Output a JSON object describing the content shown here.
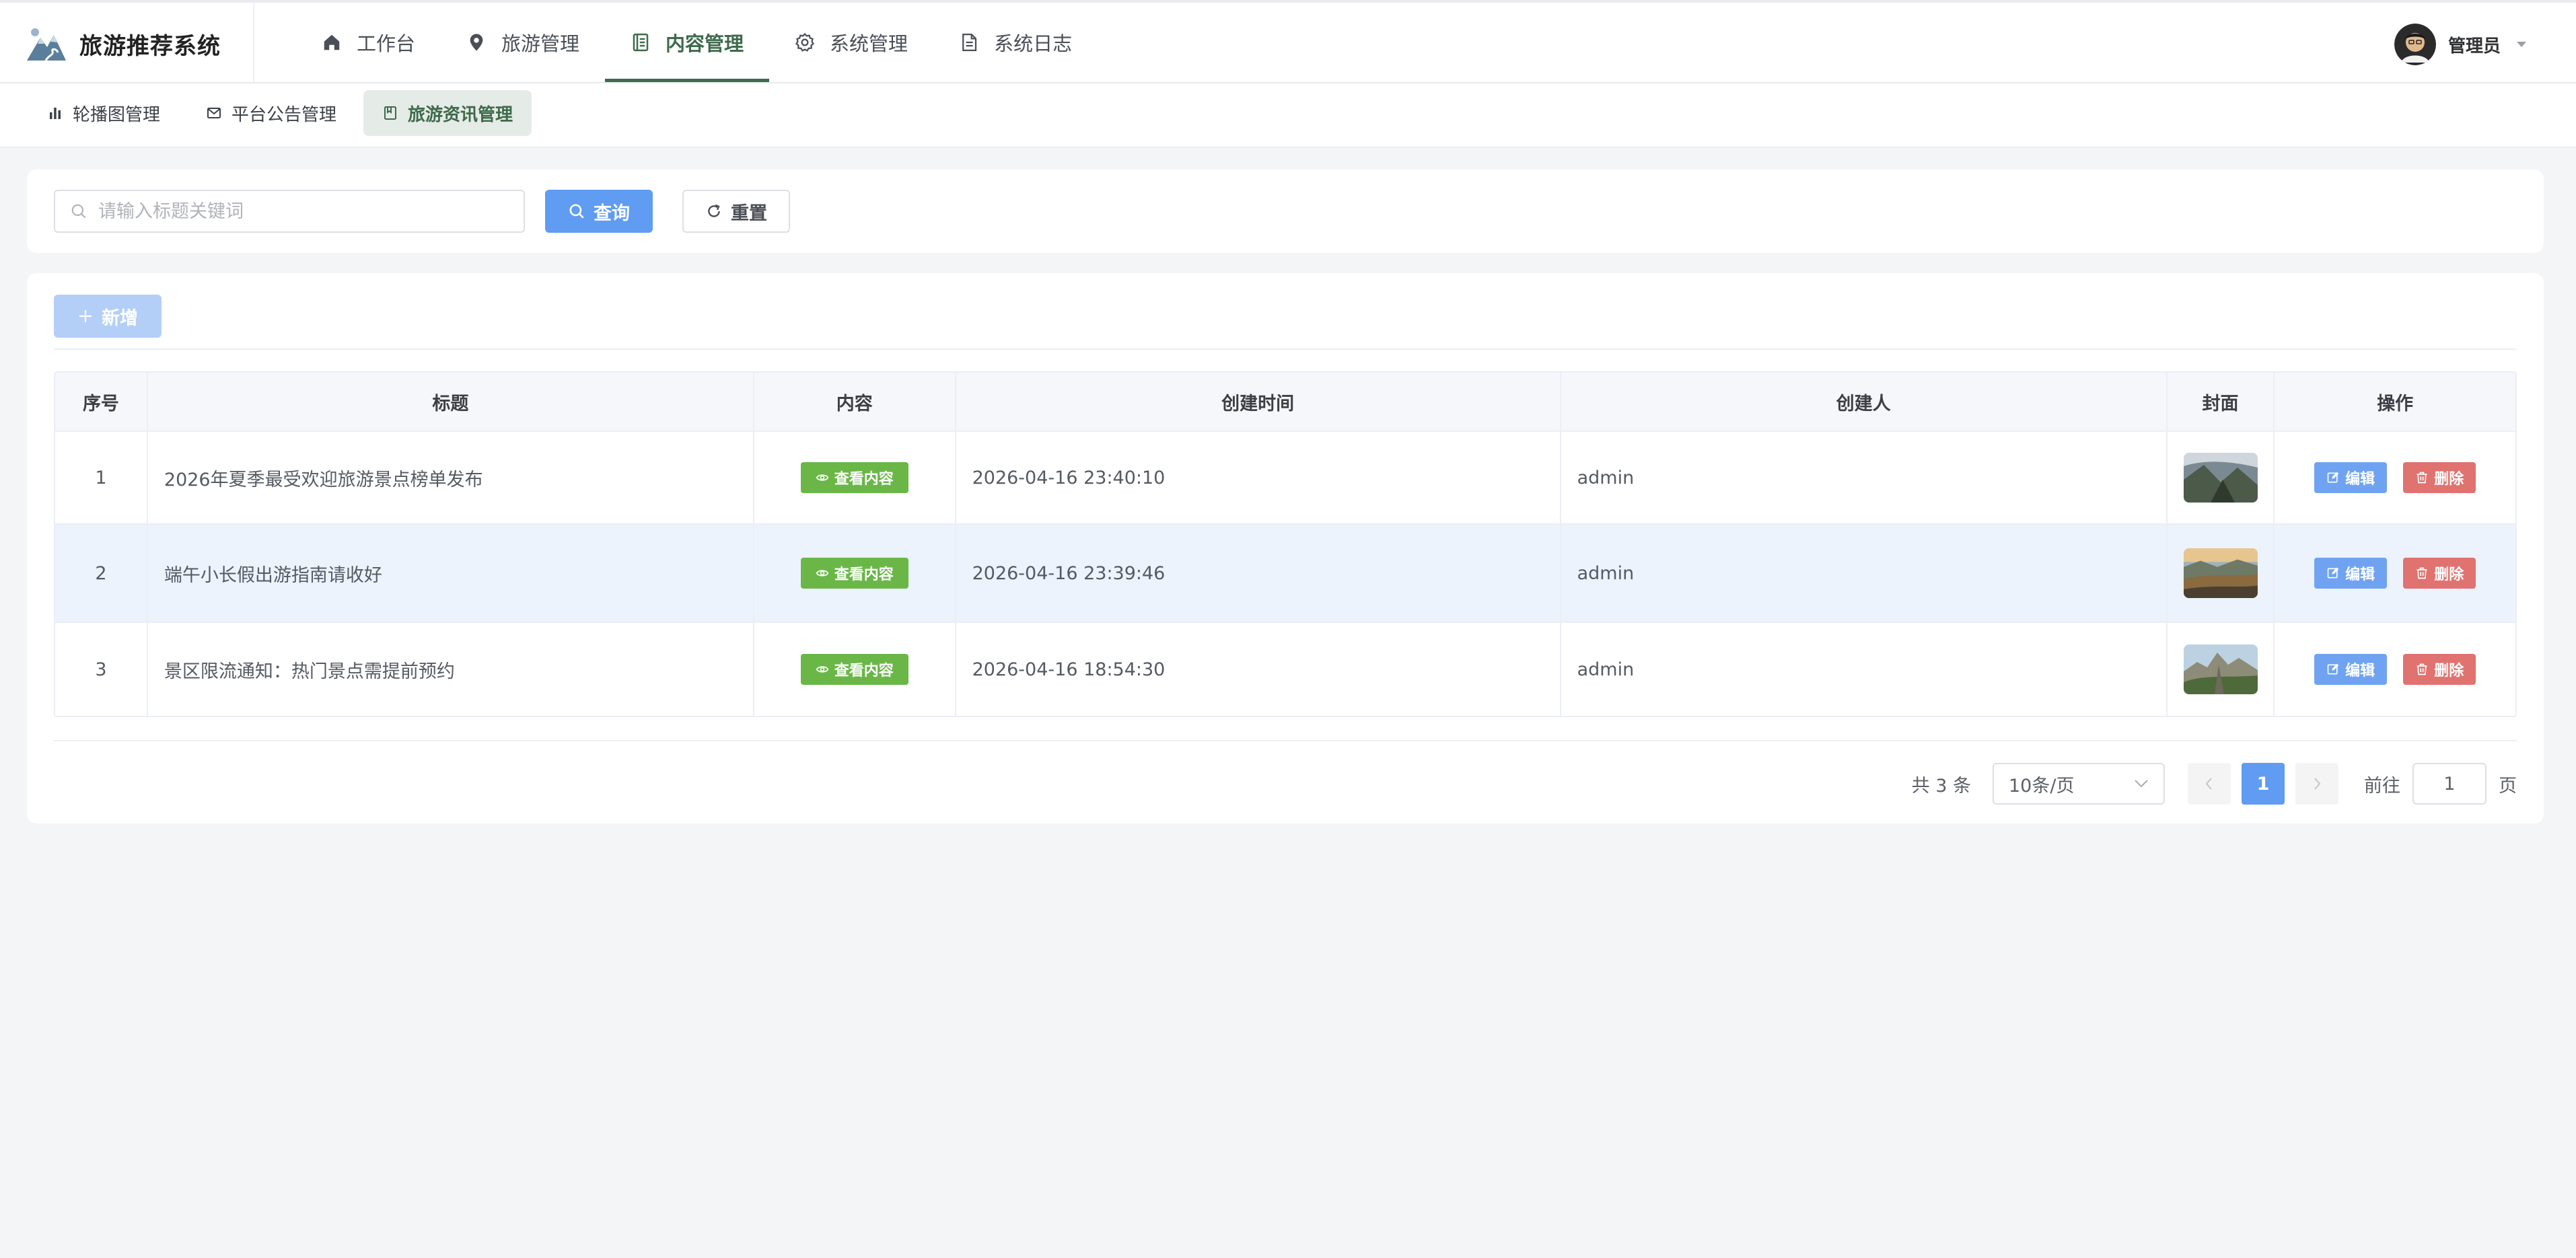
{
  "app": {
    "title": "旅游推荐系统"
  },
  "nav": [
    {
      "label": "工作台",
      "icon": "home-icon"
    },
    {
      "label": "旅游管理",
      "icon": "location-pin-icon"
    },
    {
      "label": "内容管理",
      "icon": "document-icon",
      "active": true
    },
    {
      "label": "系统管理",
      "icon": "gear-icon"
    },
    {
      "label": "系统日志",
      "icon": "log-file-icon"
    }
  ],
  "user": {
    "name": "管理员"
  },
  "subtabs": [
    {
      "label": "轮播图管理",
      "icon": "bar-chart-icon"
    },
    {
      "label": "平台公告管理",
      "icon": "mail-icon"
    },
    {
      "label": "旅游资讯管理",
      "icon": "notebook-icon",
      "active": true
    }
  ],
  "search": {
    "placeholder": "请输入标题关键词",
    "value": "",
    "query_label": "查询",
    "reset_label": "重置"
  },
  "toolbar": {
    "add_label": "新增"
  },
  "table": {
    "columns": [
      "序号",
      "标题",
      "内容",
      "创建时间",
      "创建人",
      "封面",
      "操作"
    ],
    "view_label": "查看内容",
    "edit_label": "编辑",
    "delete_label": "删除",
    "rows": [
      {
        "index": "1",
        "title": "2026年夏季最受欢迎旅游景点榜单发布",
        "created_at": "2026-04-16 23:40:10",
        "creator": "admin"
      },
      {
        "index": "2",
        "title": "端午小长假出游指南请收好",
        "created_at": "2026-04-16 23:39:46",
        "creator": "admin"
      },
      {
        "index": "3",
        "title": "景区限流通知：热门景点需提前预约",
        "created_at": "2026-04-16 18:54:30",
        "creator": "admin"
      }
    ]
  },
  "pagination": {
    "total_label": "共 3 条",
    "page_size": "10条/页",
    "current_page": "1",
    "goto_label": "前往",
    "goto_value": "1",
    "unit_label": "页"
  },
  "colors": {
    "accent_green": "#3f6b4d",
    "primary_blue": "#5f9cf2",
    "success_green": "#6ab748",
    "danger_red": "#e0726f"
  }
}
